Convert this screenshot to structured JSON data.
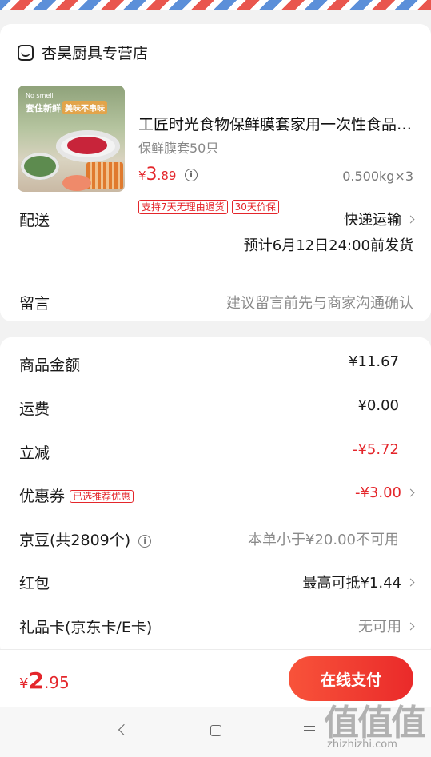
{
  "shop": {
    "name": "杏昊厨具专营店"
  },
  "product": {
    "title": "工匠时光食物保鲜膜套家用一次性食品级保鲜膜",
    "spec": "保鲜膜套50只",
    "price_currency": "¥",
    "price_int": "3",
    "price_dec": ".89",
    "weight_qty": "0.500kg×3",
    "tags": [
      "支持7天无理由退货",
      "30天价保"
    ],
    "image_text": {
      "brand_en": "No smell",
      "slogan": "套住新鲜",
      "badge": "美味不串味"
    }
  },
  "delivery": {
    "label": "配送",
    "method": "快递运输",
    "estimate": "预计6月12日24:00前发货"
  },
  "message": {
    "label": "留言",
    "placeholder": "建议留言前先与商家沟通确认"
  },
  "summary": {
    "goods_amount": {
      "label": "商品金额",
      "value": "¥11.67"
    },
    "shipping": {
      "label": "运费",
      "value": "¥0.00"
    },
    "discount": {
      "label": "立减",
      "value": "-¥5.72"
    },
    "coupon": {
      "label": "优惠券",
      "badge": "已选推荐优惠",
      "value": "-¥3.00"
    },
    "jingdou": {
      "label": "京豆(共2809个)",
      "value": "本单小于¥20.00不可用"
    },
    "red_packet": {
      "label": "红包",
      "value": "最高可抵¥1.44"
    },
    "gift_card": {
      "label": "礼品卡(京东卡/E卡)",
      "value": "无可用"
    }
  },
  "checkout": {
    "total_currency": "¥",
    "total_int": "2",
    "total_dec": ".95",
    "pay_label": "在线支付"
  },
  "watermark": {
    "big": "值值值",
    "small": "zhizhizhi.com"
  },
  "colors": {
    "accent": "#e4262b",
    "pay_gradient_start": "#f8533a",
    "pay_gradient_end": "#ea2a2a"
  }
}
